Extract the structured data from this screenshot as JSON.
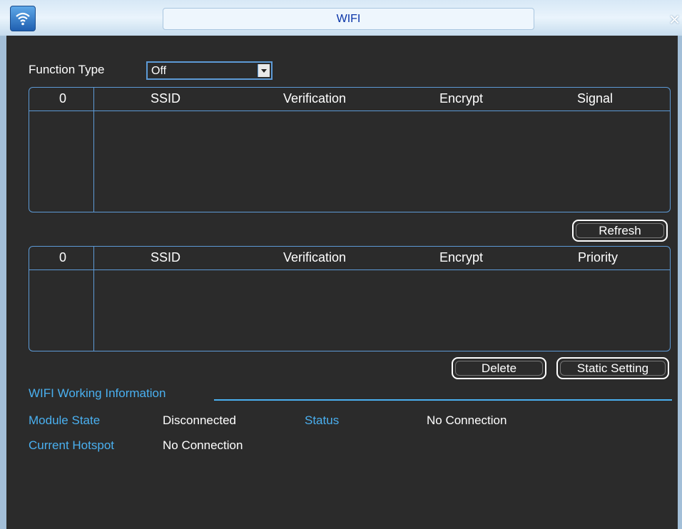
{
  "window": {
    "title": "WIFI",
    "close_glyph": "×",
    "icon": "wifi-icon"
  },
  "function_type": {
    "label": "Function Type",
    "value": "Off"
  },
  "scan_table": {
    "columns": [
      "0",
      "SSID",
      "Verification",
      "Encrypt",
      "Signal"
    ],
    "rows": []
  },
  "refresh_label": "Refresh",
  "saved_table": {
    "columns": [
      "0",
      "SSID",
      "Verification",
      "Encrypt",
      "Priority"
    ],
    "rows": []
  },
  "delete_label": "Delete",
  "static_setting_label": "Static Setting",
  "info": {
    "heading": "WIFI Working Information",
    "module_state_label": "Module State",
    "module_state_value": "Disconnected",
    "status_label": "Status",
    "status_value": "No Connection",
    "hotspot_label": "Current Hotspot",
    "hotspot_value": "No Connection"
  },
  "colors": {
    "accent": "#4ab0f0",
    "border": "#5d9ad6",
    "background": "#2b2b2b",
    "title_text": "#0a35a8"
  }
}
